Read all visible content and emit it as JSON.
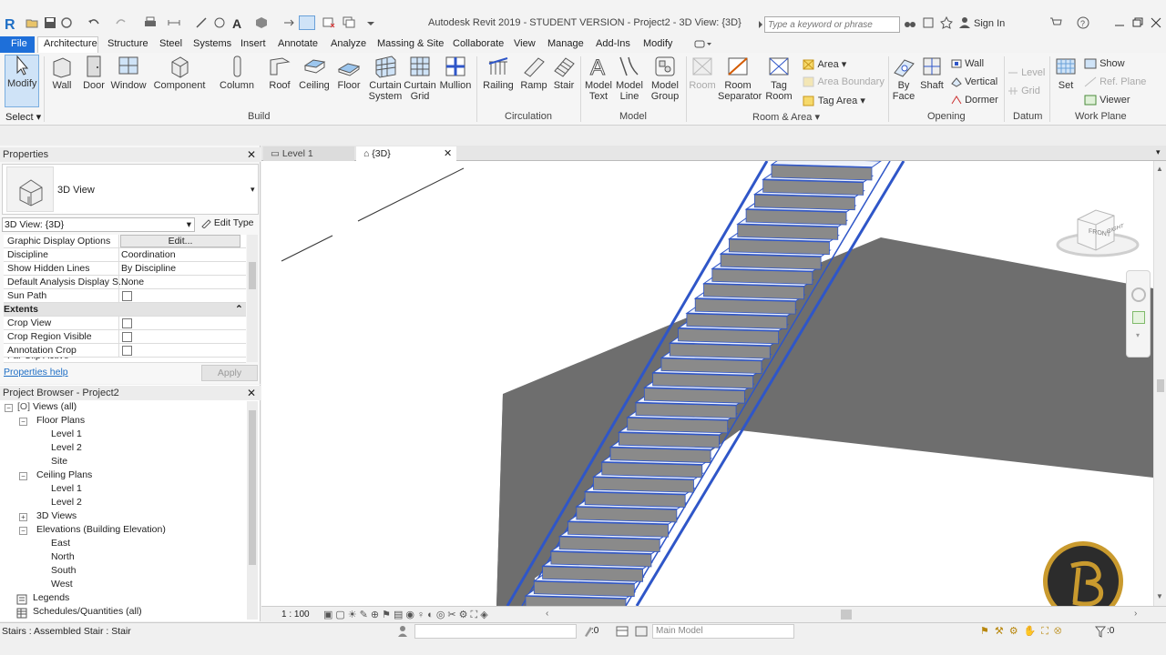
{
  "app": {
    "title": "Autodesk Revit 2019 - STUDENT VERSION - Project2 - 3D View: {3D}",
    "search_placeholder": "Type a keyword or phrase",
    "sign_in": "Sign In"
  },
  "ribbon_tabs": [
    "File",
    "Architecture",
    "Structure",
    "Steel",
    "Systems",
    "Insert",
    "Annotate",
    "Analyze",
    "Massing & Site",
    "Collaborate",
    "View",
    "Manage",
    "Add-Ins",
    "Modify"
  ],
  "ribbon": {
    "modify": "Modify",
    "select": "Select",
    "build": {
      "label": "Build",
      "buttons": [
        "Wall",
        "Door",
        "Window",
        "Component",
        "Column",
        "Roof",
        "Ceiling",
        "Floor",
        "Curtain System",
        "Curtain Grid",
        "Mullion"
      ]
    },
    "circulation": {
      "label": "Circulation",
      "buttons": [
        "Railing",
        "Ramp",
        "Stair"
      ]
    },
    "model": {
      "label": "Model",
      "buttons": [
        "Model Text",
        "Model Line",
        "Model Group"
      ]
    },
    "room_area": {
      "label": "Room & Area",
      "buttons": [
        "Room",
        "Room Separator",
        "Tag Room"
      ],
      "small": [
        "Area",
        "Area Boundary",
        "Tag Area"
      ]
    },
    "opening": {
      "label": "Opening",
      "buttons": [
        "By Face",
        "Shaft"
      ],
      "small": [
        "Wall",
        "Vertical",
        "Dormer"
      ]
    },
    "datum": {
      "label": "Datum",
      "small": [
        "Level",
        "Grid"
      ]
    },
    "work_plane": {
      "label": "Work Plane",
      "buttons": [
        "Set"
      ],
      "small": [
        "Show",
        "Ref. Plane",
        "Viewer"
      ]
    }
  },
  "properties": {
    "title": "Properties",
    "type_name": "3D View",
    "selector": "3D View: {3D}",
    "edit_type": "Edit Type",
    "rows": [
      {
        "key": "Graphic Display Options",
        "value": "Edit..."
      },
      {
        "key": "Discipline",
        "value": "Coordination"
      },
      {
        "key": "Show Hidden Lines",
        "value": "By Discipline"
      },
      {
        "key": "Default Analysis Display S...",
        "value": "None"
      },
      {
        "key": "Sun Path",
        "value": ""
      }
    ],
    "section_extents": "Extents",
    "extents_rows": [
      {
        "key": "Crop View",
        "value": ""
      },
      {
        "key": "Crop Region Visible",
        "value": ""
      },
      {
        "key": "Annotation Crop",
        "value": ""
      },
      {
        "key": "Far Clip Active",
        "value": ""
      }
    ],
    "help_link": "Properties help",
    "apply": "Apply"
  },
  "project_browser": {
    "title": "Project Browser - Project2",
    "items": [
      {
        "label": "Views (all)",
        "level": 0
      },
      {
        "label": "Floor Plans",
        "level": 1
      },
      {
        "label": "Level 1",
        "level": 2
      },
      {
        "label": "Level 2",
        "level": 2
      },
      {
        "label": "Site",
        "level": 2
      },
      {
        "label": "Ceiling Plans",
        "level": 1
      },
      {
        "label": "Level 1",
        "level": 2
      },
      {
        "label": "Level 2",
        "level": 2
      },
      {
        "label": "3D Views",
        "level": 1
      },
      {
        "label": "Elevations (Building Elevation)",
        "level": 1
      },
      {
        "label": "East",
        "level": 2
      },
      {
        "label": "North",
        "level": 2
      },
      {
        "label": "South",
        "level": 2
      },
      {
        "label": "West",
        "level": 2
      },
      {
        "label": "Legends",
        "level": 0
      },
      {
        "label": "Schedules/Quantities (all)",
        "level": 0
      }
    ]
  },
  "view_tabs": [
    {
      "label": "Level 1",
      "active": false
    },
    {
      "label": "{3D}",
      "active": true
    }
  ],
  "viewcube": {
    "front": "FRONT",
    "right": "RIGHT"
  },
  "view_control": {
    "scale": "1 : 100"
  },
  "status": {
    "text": "Stairs : Assembled Stair : Stair",
    "workset_count": ":0",
    "model": "Main Model",
    "filter_count": ":0"
  },
  "colors": {
    "accent": "#1f6fc5",
    "stair_blue": "#2f56c8",
    "slab_gray": "#6e6e6e",
    "tab_file": "#1e6fd9"
  }
}
